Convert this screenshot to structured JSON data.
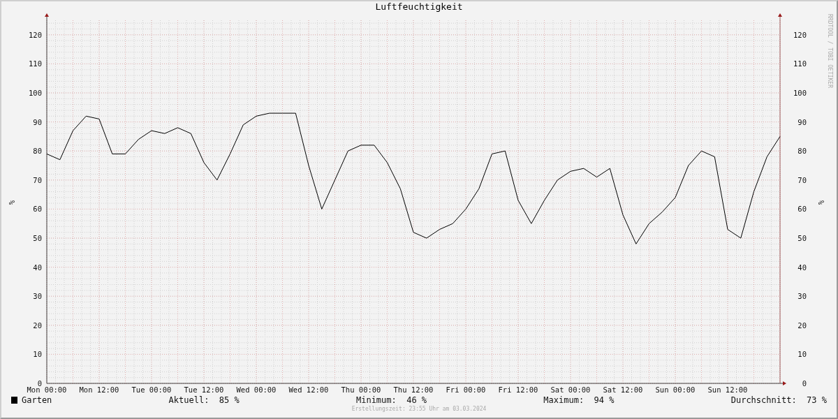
{
  "chart_data": {
    "type": "line",
    "title": "Luftfeuchtigkeit",
    "ylabel": "%",
    "grid": true,
    "ylim": [
      0,
      125
    ],
    "categories": [
      "Mon 00:00",
      null,
      null,
      null,
      "Mon 12:00",
      null,
      null,
      null,
      "Tue 00:00",
      null,
      null,
      null,
      "Tue 12:00",
      null,
      null,
      null,
      "Wed 00:00",
      null,
      null,
      null,
      "Wed 12:00",
      null,
      null,
      null,
      "Thu 00:00",
      null,
      null,
      null,
      "Thu 12:00",
      null,
      null,
      null,
      "Fri 00:00",
      null,
      null,
      null,
      "Fri 12:00",
      null,
      null,
      null,
      "Sat 00:00",
      null,
      null,
      null,
      "Sat 12:00",
      null,
      null,
      null,
      "Sun 00:00",
      null,
      null,
      null,
      "Sun 12:00",
      null,
      null,
      null,
      null
    ],
    "yticks": [
      0,
      10,
      20,
      30,
      40,
      50,
      60,
      70,
      80,
      90,
      100,
      110,
      120
    ],
    "series": [
      {
        "name": "Garten",
        "color": "#000000",
        "values": [
          79,
          77,
          87,
          92,
          91,
          79,
          79,
          84,
          87,
          86,
          88,
          86,
          76,
          70,
          79,
          89,
          92,
          93,
          93,
          93,
          75,
          60,
          70,
          80,
          82,
          82,
          76,
          67,
          52,
          50,
          53,
          55,
          60,
          67,
          79,
          80,
          63,
          55,
          63,
          70,
          73,
          74,
          71,
          74,
          58,
          48,
          55,
          59,
          64,
          75,
          80,
          78,
          53,
          50,
          66,
          78,
          85
        ]
      }
    ]
  },
  "right_axis": {
    "label": "%",
    "ticks": [
      "120",
      "110",
      "100",
      "90",
      "80",
      "70",
      "60",
      "50",
      "40",
      "30",
      "20",
      "10",
      "0"
    ]
  },
  "credit": "RRDTOOL / TOBI OETIKER",
  "stats": [
    {
      "label": "Aktuell:",
      "value": "85 %"
    },
    {
      "label": "Minimum:",
      "value": "46 %"
    },
    {
      "label": "Maximum:",
      "value": "94 %"
    },
    {
      "label": "Durchschnitt:",
      "value": "73 %"
    }
  ],
  "footer": "Erstellungszeit: 23:55 Uhr am 03.03.2024"
}
